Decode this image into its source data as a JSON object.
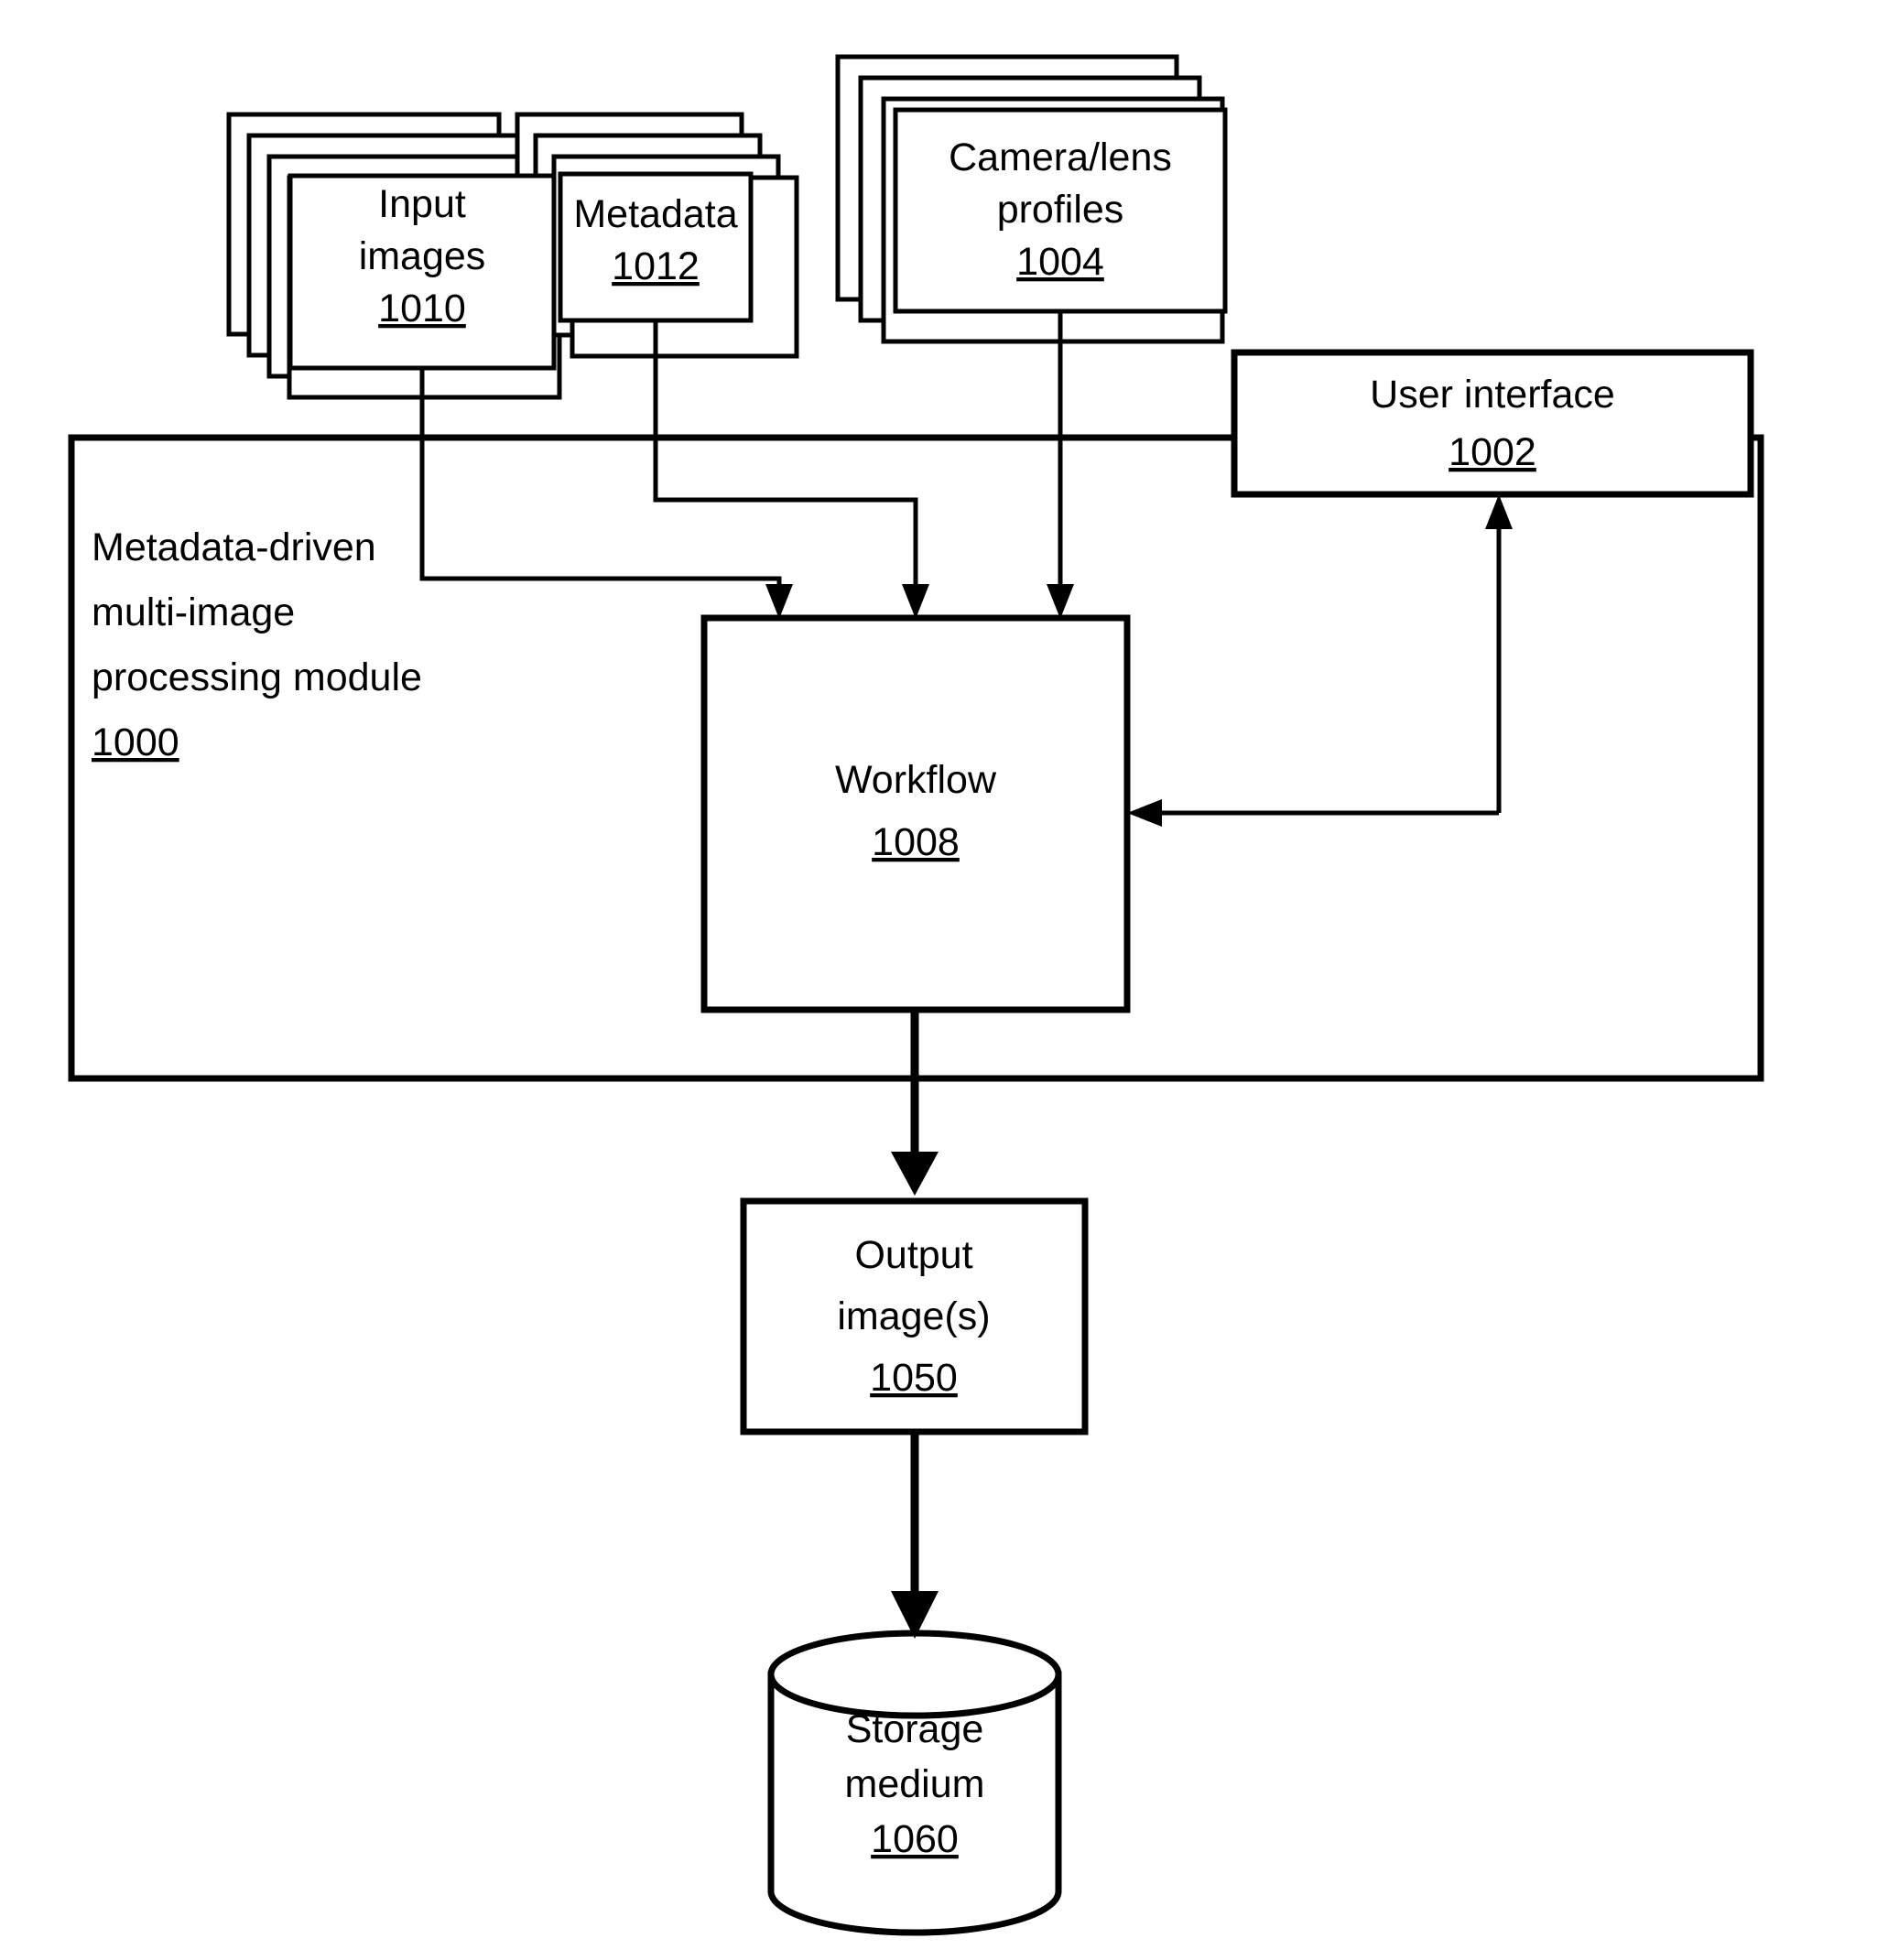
{
  "figure": {
    "type": "patent-block-diagram",
    "background_color": "#ffffff",
    "line_color": "#000000"
  },
  "nodes": {
    "input_images": {
      "label_line1": "Input",
      "label_line2": "images",
      "ref": "1010",
      "shape": "stacked-document",
      "stack_count": 5
    },
    "metadata": {
      "label_line1": "Metadata",
      "ref": "1012",
      "shape": "stacked-document",
      "stack_count": 5
    },
    "camera_lens_profiles": {
      "label_line1": "Camera/lens",
      "label_line2": "profiles",
      "ref": "1004",
      "shape": "stacked-document",
      "stack_count": 4
    },
    "user_interface": {
      "label_line1": "User interface",
      "ref": "1002",
      "shape": "rectangle"
    },
    "processing_module": {
      "label_line1": "Metadata-driven",
      "label_line2": "multi-image",
      "label_line3": "processing module",
      "ref": "1000",
      "shape": "rectangle-container"
    },
    "workflow": {
      "label_line1": "Workflow",
      "ref": "1008",
      "shape": "rectangle"
    },
    "output_images": {
      "label_line1": "Output",
      "label_line2": "image(s)",
      "ref": "1050",
      "shape": "rectangle"
    },
    "storage_medium": {
      "label_line1": "Storage",
      "label_line2": "medium",
      "ref": "1060",
      "shape": "cylinder"
    }
  },
  "edges": [
    {
      "id": "input-to-workflow",
      "from": "input_images",
      "to": "workflow",
      "arrow": "down"
    },
    {
      "id": "metadata-to-workflow",
      "from": "metadata",
      "to": "workflow",
      "arrow": "down"
    },
    {
      "id": "profiles-to-workflow",
      "from": "camera_lens_profiles",
      "to": "workflow",
      "arrow": "down"
    },
    {
      "id": "ui-to-workflow",
      "from": "user_interface",
      "to": "workflow",
      "arrow": "left"
    },
    {
      "id": "workflow-to-ui",
      "from": "workflow",
      "to": "user_interface",
      "arrow": "up"
    },
    {
      "id": "workflow-to-output",
      "from": "workflow",
      "to": "output_images",
      "arrow": "down"
    },
    {
      "id": "output-to-storage",
      "from": "output_images",
      "to": "storage_medium",
      "arrow": "down"
    }
  ]
}
